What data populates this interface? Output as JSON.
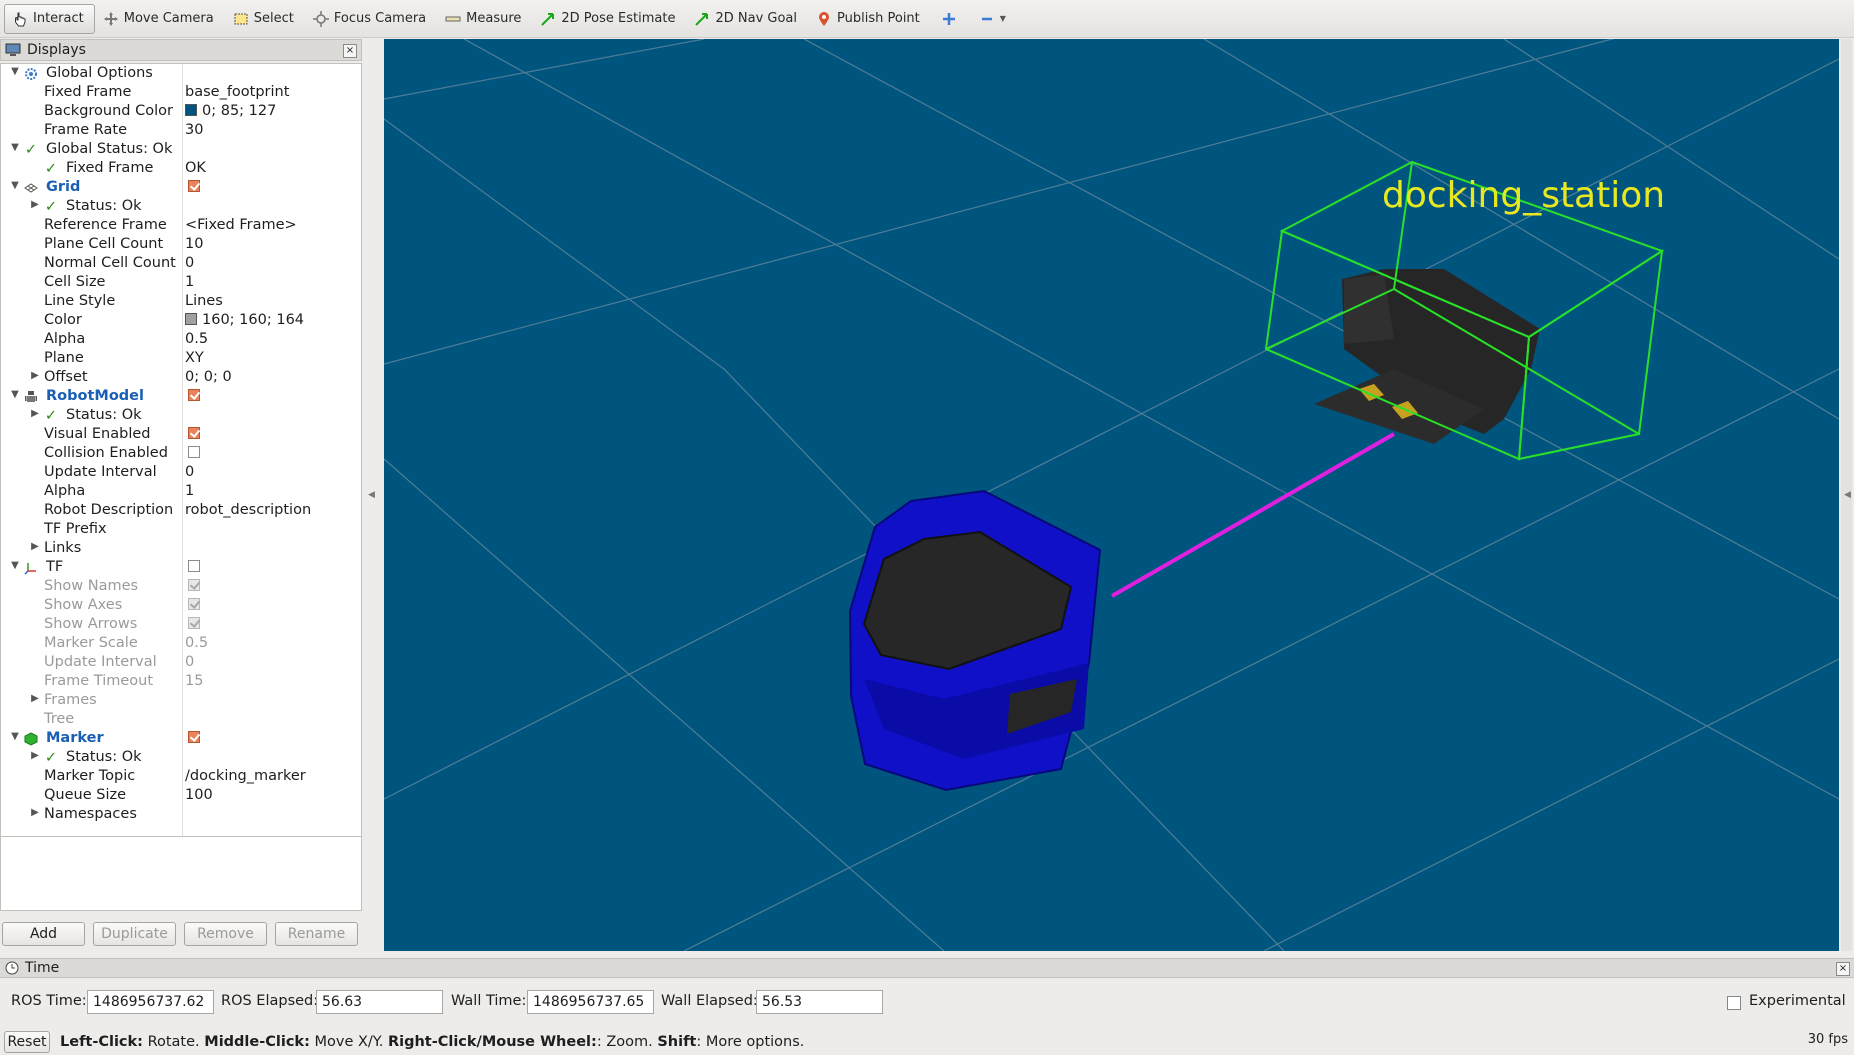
{
  "toolbar": {
    "tools": [
      {
        "label": "Interact",
        "icon": "hand-pointer-icon",
        "active": true
      },
      {
        "label": "Move Camera",
        "icon": "move-camera-icon",
        "active": false
      },
      {
        "label": "Select",
        "icon": "select-box-icon",
        "active": false
      },
      {
        "label": "Focus Camera",
        "icon": "focus-camera-icon",
        "active": false
      },
      {
        "label": "Measure",
        "icon": "ruler-icon",
        "active": false
      },
      {
        "label": "2D Pose Estimate",
        "icon": "green-arrow-icon",
        "active": false
      },
      {
        "label": "2D Nav Goal",
        "icon": "green-arrow-icon",
        "active": false
      },
      {
        "label": "Publish Point",
        "icon": "map-pin-icon",
        "active": false
      }
    ]
  },
  "displays": {
    "title": "Displays",
    "rows": [
      {
        "name": "Global Options",
        "value": ""
      },
      {
        "name": "Fixed Frame",
        "value": "base_footprint"
      },
      {
        "name": "Background Color",
        "value": "0; 85; 127"
      },
      {
        "name": "Frame Rate",
        "value": "30"
      },
      {
        "name": "Global Status: Ok",
        "value": ""
      },
      {
        "name": "Fixed Frame",
        "value": "OK"
      },
      {
        "name": "Grid",
        "value": ""
      },
      {
        "name": "Status: Ok",
        "value": ""
      },
      {
        "name": "Reference Frame",
        "value": "<Fixed Frame>"
      },
      {
        "name": "Plane Cell Count",
        "value": "10"
      },
      {
        "name": "Normal Cell Count",
        "value": "0"
      },
      {
        "name": "Cell Size",
        "value": "1"
      },
      {
        "name": "Line Style",
        "value": "Lines"
      },
      {
        "name": "Color",
        "value": "160; 160; 164"
      },
      {
        "name": "Alpha",
        "value": "0.5"
      },
      {
        "name": "Plane",
        "value": "XY"
      },
      {
        "name": "Offset",
        "value": "0; 0; 0"
      },
      {
        "name": "RobotModel",
        "value": ""
      },
      {
        "name": "Status: Ok",
        "value": ""
      },
      {
        "name": "Visual Enabled",
        "value": ""
      },
      {
        "name": "Collision Enabled",
        "value": ""
      },
      {
        "name": "Update Interval",
        "value": "0"
      },
      {
        "name": "Alpha",
        "value": "1"
      },
      {
        "name": "Robot Description",
        "value": "robot_description"
      },
      {
        "name": "TF Prefix",
        "value": ""
      },
      {
        "name": "Links",
        "value": ""
      },
      {
        "name": "TF",
        "value": ""
      },
      {
        "name": "Show Names",
        "value": ""
      },
      {
        "name": "Show Axes",
        "value": ""
      },
      {
        "name": "Show Arrows",
        "value": ""
      },
      {
        "name": "Marker Scale",
        "value": "0.5"
      },
      {
        "name": "Update Interval",
        "value": "0"
      },
      {
        "name": "Frame Timeout",
        "value": "15"
      },
      {
        "name": "Frames",
        "value": ""
      },
      {
        "name": "Tree",
        "value": ""
      },
      {
        "name": "Marker",
        "value": ""
      },
      {
        "name": "Status: Ok",
        "value": ""
      },
      {
        "name": "Marker Topic",
        "value": "/docking_marker"
      },
      {
        "name": "Queue Size",
        "value": "100"
      },
      {
        "name": "Namespaces",
        "value": ""
      }
    ],
    "buttons": {
      "add": "Add",
      "duplicate": "Duplicate",
      "remove": "Remove",
      "rename": "Rename"
    }
  },
  "viewport": {
    "background_color": "#00557f",
    "marker_label": "docking_station"
  },
  "time": {
    "title": "Time",
    "ros_time_label": "ROS Time:",
    "ros_time": "1486956737.62",
    "ros_elapsed_label": "ROS Elapsed:",
    "ros_elapsed": "56.63",
    "wall_time_label": "Wall Time:",
    "wall_time": "1486956737.65",
    "wall_elapsed_label": "Wall Elapsed:",
    "wall_elapsed": "56.53",
    "experimental_label": "Experimental"
  },
  "status": {
    "reset": "Reset",
    "hint_left_click": "Left-Click:",
    "hint_left_action": "Rotate.",
    "hint_middle_click": "Middle-Click:",
    "hint_middle_action": "Move X/Y.",
    "hint_right_click": "Right-Click/Mouse Wheel:",
    "hint_right_action": ": Zoom.",
    "hint_shift": "Shift",
    "hint_shift_action": ": More options.",
    "fps": "30 fps"
  }
}
